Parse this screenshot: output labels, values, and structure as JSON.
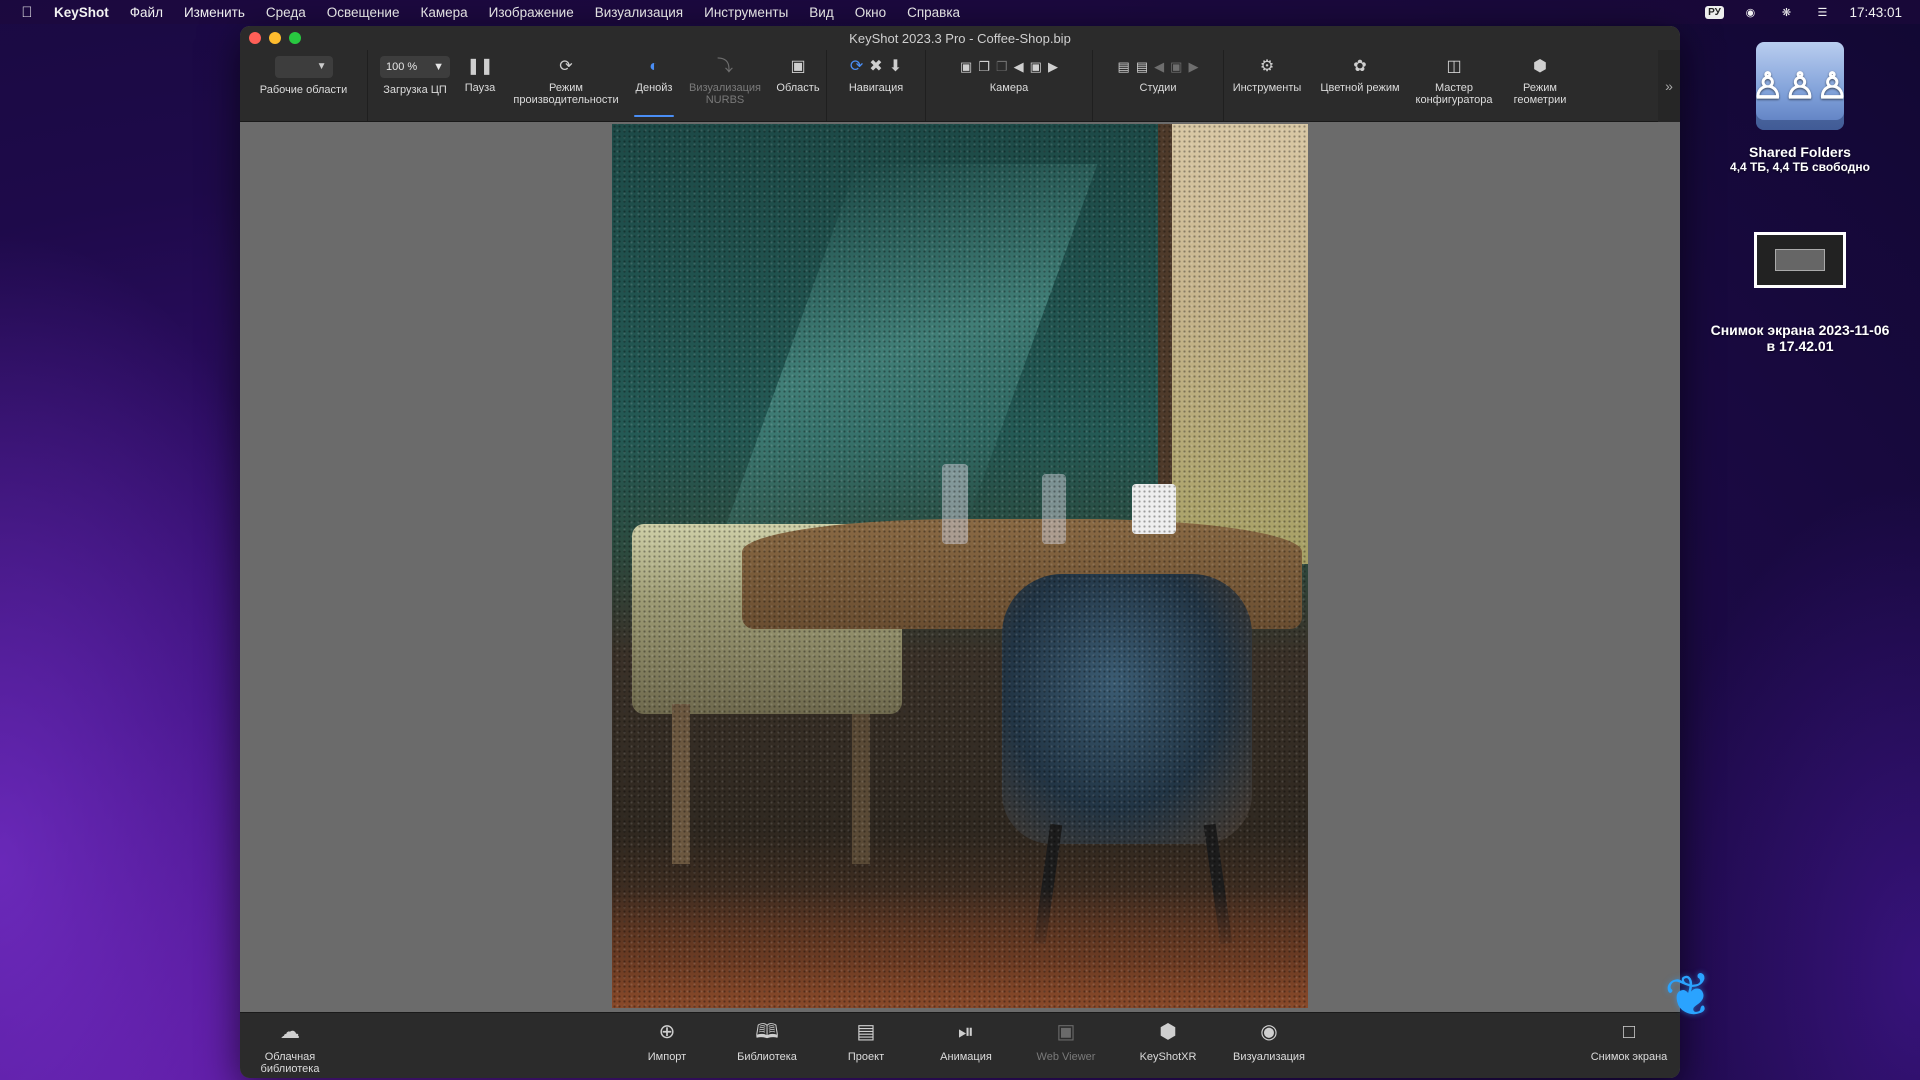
{
  "menubar": {
    "app_name": "KeyShot",
    "items": [
      "Файл",
      "Изменить",
      "Среда",
      "Освещение",
      "Камера",
      "Изображение",
      "Визуализация",
      "Инструменты",
      "Вид",
      "Окно",
      "Справка"
    ],
    "input_lang": "РУ",
    "clock": "17:43:01"
  },
  "window": {
    "title": "KeyShot 2023.3 Pro  - Coffee-Shop.bip"
  },
  "toolbar": {
    "workspaces_label": "Рабочие области",
    "zoom_value": "100 %",
    "cpu_label": "Загрузка ЦП",
    "pause_label": "Пауза",
    "performance_label_1": "Режим",
    "performance_label_2": "производительности",
    "denoise_label": "Денойз",
    "nurbs_label_1": "Визуализация",
    "nurbs_label_2": "NURBS",
    "region_label": "Область",
    "navigation_label": "Навигация",
    "camera_label": "Камера",
    "studios_label": "Студии",
    "tools_label": "Инструменты",
    "color_mode_label": "Цветной режим",
    "configurator_label_1": "Мастер",
    "configurator_label_2": "конфигуратора",
    "geometry_label_1": "Режим",
    "geometry_label_2": "геометрии"
  },
  "bottombar": {
    "cloud_library_1": "Облачная",
    "cloud_library_2": "библиотека",
    "import": "Импорт",
    "library": "Библиотека",
    "project": "Проект",
    "animation": "Анимация",
    "web_viewer": "Web Viewer",
    "keyshotxr": "KeyShotXR",
    "render": "Визуализация",
    "screenshot": "Снимок экрана"
  },
  "desktop": {
    "drive_name": "Shared Folders",
    "drive_info": "4,4 ТБ, 4,4 ТБ свободно",
    "screenshot_file_1": "Снимок экрана 2023-11-06",
    "screenshot_file_2": "в 17.42.01"
  },
  "icons": {
    "apple": "apple-logo-icon",
    "accent": "#4a8ef5"
  }
}
